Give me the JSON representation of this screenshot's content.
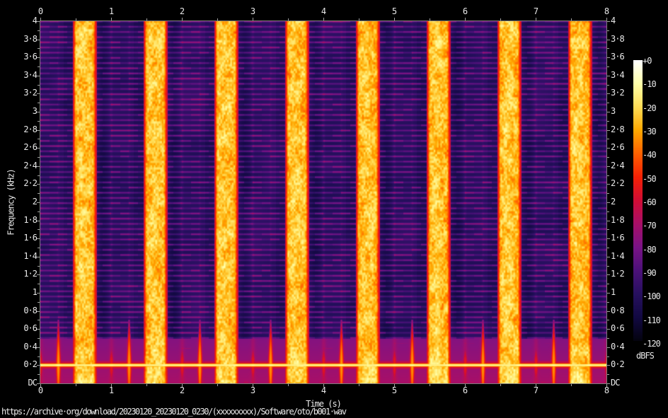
{
  "caption": {
    "url_text": "https://archive·org/download/20230120_20230120_0230/(xxxxxxxxx)/Software/oto/b001·wav"
  },
  "chart_data": {
    "type": "heatmap",
    "subtype": "audio-spectrogram",
    "title": "",
    "xlabel": "Time (s)",
    "ylabel": "Frequency (kHz)",
    "xlim_s": [
      0,
      8
    ],
    "ylim_khz": [
      0,
      4
    ],
    "grid": false,
    "x_ticks": [
      {
        "label": "0",
        "s": 0
      },
      {
        "label": "1",
        "s": 1
      },
      {
        "label": "2",
        "s": 2
      },
      {
        "label": "3",
        "s": 3
      },
      {
        "label": "4",
        "s": 4
      },
      {
        "label": "5",
        "s": 5
      },
      {
        "label": "6",
        "s": 6
      },
      {
        "label": "7",
        "s": 7
      },
      {
        "label": "8",
        "s": 8
      }
    ],
    "x_minor_tick_step_s": 0.5,
    "y_ticks": [
      {
        "label": "4",
        "khz": 4.0
      },
      {
        "label": "3·8",
        "khz": 3.8
      },
      {
        "label": "3·6",
        "khz": 3.6
      },
      {
        "label": "3·4",
        "khz": 3.4
      },
      {
        "label": "3·2",
        "khz": 3.2
      },
      {
        "label": "3",
        "khz": 3.0
      },
      {
        "label": "2·8",
        "khz": 2.8
      },
      {
        "label": "2·6",
        "khz": 2.6
      },
      {
        "label": "2·4",
        "khz": 2.4
      },
      {
        "label": "2·2",
        "khz": 2.2
      },
      {
        "label": "2",
        "khz": 2.0
      },
      {
        "label": "1·8",
        "khz": 1.8
      },
      {
        "label": "1·6",
        "khz": 1.6
      },
      {
        "label": "1·4",
        "khz": 1.4
      },
      {
        "label": "1·2",
        "khz": 1.2
      },
      {
        "label": "1",
        "khz": 1.0
      },
      {
        "label": "0·8",
        "khz": 0.8
      },
      {
        "label": "0·6",
        "khz": 0.6
      },
      {
        "label": "0·4",
        "khz": 0.4
      },
      {
        "label": "0·2",
        "khz": 0.2
      },
      {
        "label": "DC",
        "khz": 0.0
      }
    ],
    "y_minor_tick_step_khz": 0.1,
    "colorbar": {
      "unit_label": "dBFS",
      "range_db": [
        0,
        -120
      ],
      "tick_labels": [
        "+0",
        "-10",
        "-20",
        "-30",
        "-40",
        "-50",
        "-60",
        "-70",
        "-80",
        "-90",
        "-100",
        "-110",
        "-120"
      ],
      "palette_stops": [
        {
          "db": 0,
          "color": "#ffffff"
        },
        {
          "db": -10,
          "color": "#ffffa8"
        },
        {
          "db": -20,
          "color": "#ffdc55"
        },
        {
          "db": -30,
          "color": "#ffa800"
        },
        {
          "db": -40,
          "color": "#ff6000"
        },
        {
          "db": -50,
          "color": "#f42105"
        },
        {
          "db": -60,
          "color": "#d00d35"
        },
        {
          "db": -70,
          "color": "#a80f68"
        },
        {
          "db": -80,
          "color": "#7a1386"
        },
        {
          "db": -90,
          "color": "#4c1179"
        },
        {
          "db": -100,
          "color": "#27105f"
        },
        {
          "db": -110,
          "color": "#120942"
        },
        {
          "db": -120,
          "color": "#040310"
        }
      ]
    },
    "content": {
      "description": "Rhythmic audio loop: one broadband noise burst per second over a harmonic-striped background, a constant ~0.2 kHz tone line with low-frequency beat hits on quarter-note offsets",
      "noise_bursts": {
        "count": 8,
        "period_s": 1.0,
        "onset_s": 0.45,
        "release_s": 0.8,
        "peak_level_db": -22,
        "edge_level_db": -48
      },
      "post_burst_dip_s": [
        0.79,
        0.98
      ],
      "pre_burst_dip_s": [
        0.32,
        0.45
      ],
      "tone_khz": 0.205,
      "tone_level_db": -12,
      "beat_offsets_s": [
        0.0,
        0.25,
        0.75
      ],
      "beat_strengths": [
        0.5,
        1.0,
        0.95
      ],
      "harmonic_stripe_spacing_khz": 0.0573,
      "segment_grid_s": 0.125,
      "background_level_db": -104,
      "noise_seed": 7
    }
  }
}
